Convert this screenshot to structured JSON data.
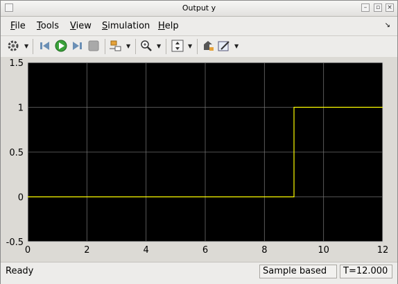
{
  "window": {
    "title": "Output y"
  },
  "menu": {
    "items": [
      {
        "label": "File"
      },
      {
        "label": "Tools"
      },
      {
        "label": "View"
      },
      {
        "label": "Simulation"
      },
      {
        "label": "Help"
      }
    ]
  },
  "toolbar": {
    "icons": [
      "gear-icon",
      "step-back-icon",
      "run-icon",
      "step-forward-icon",
      "stop-icon",
      "signal-select-icon",
      "zoom-icon",
      "autoscale-icon",
      "highlight-block-icon",
      "edit-style-icon"
    ]
  },
  "chart_data": {
    "type": "line",
    "xlim": [
      0,
      12
    ],
    "ylim": [
      -0.5,
      1.5
    ],
    "xticks": [
      "0",
      "2",
      "4",
      "6",
      "8",
      "10",
      "12"
    ],
    "yticks": [
      "-0.5",
      "0",
      "0.5",
      "1",
      "1.5"
    ],
    "grid": true,
    "series": [
      {
        "x": [
          0,
          9,
          9,
          12
        ],
        "values": [
          0,
          0,
          1,
          1
        ],
        "color": "#ffff00"
      }
    ],
    "background": "#000000"
  },
  "status": {
    "state": "Ready",
    "mode": "Sample based",
    "time": "T=12.000"
  }
}
